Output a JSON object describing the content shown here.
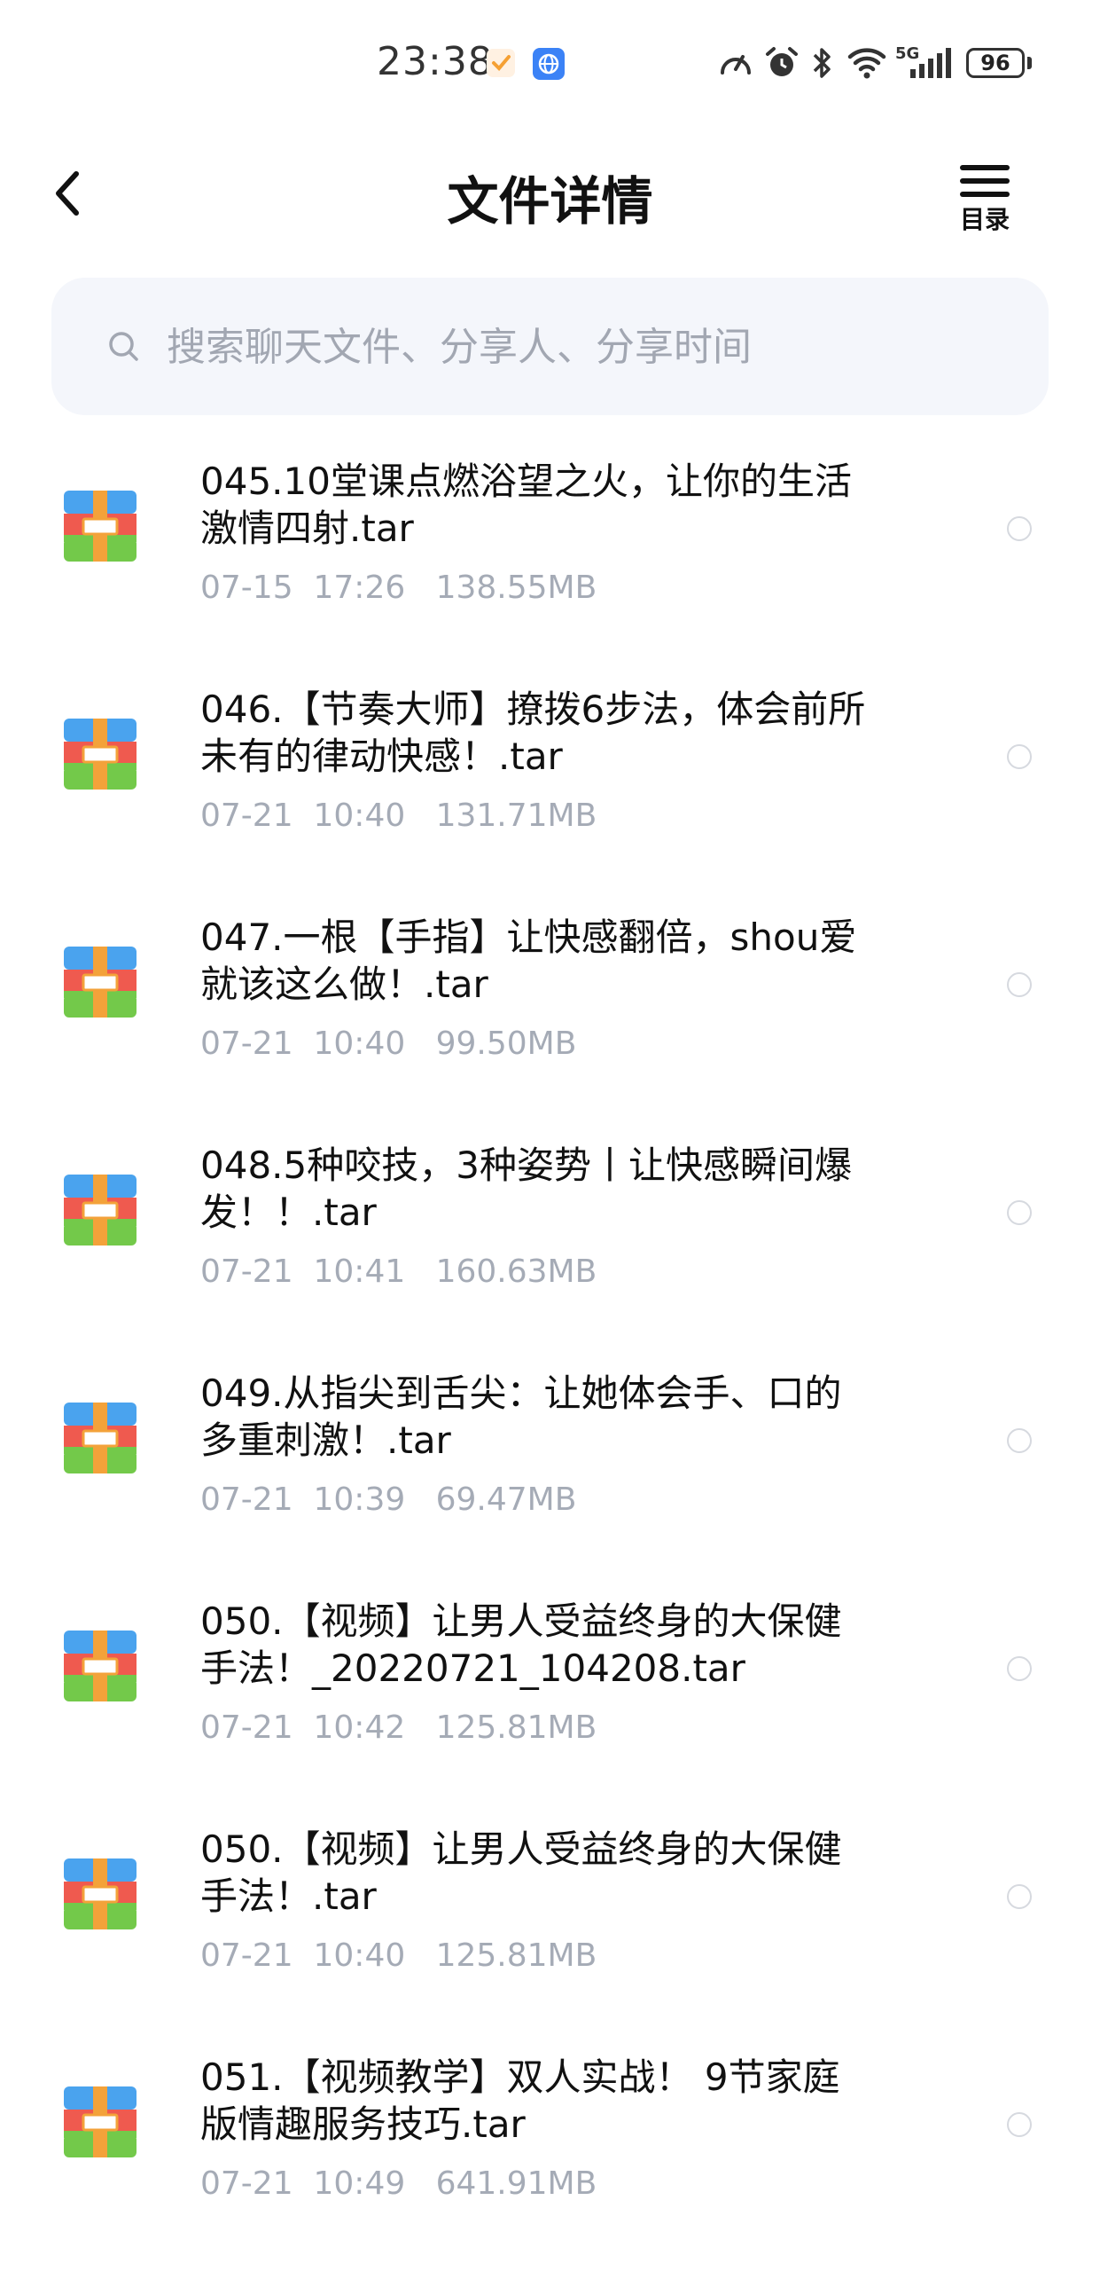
{
  "status_bar": {
    "time": "23:38",
    "battery": "96",
    "network": "5G"
  },
  "header": {
    "title": "文件详情",
    "toc_label": "目录"
  },
  "search": {
    "placeholder": "搜索聊天文件、分享人、分享时间"
  },
  "files": [
    {
      "line1": "045.10堂课点燃浴望之火，让你的生活",
      "line2": "激情四射.tar",
      "date": "07-15",
      "time": "17:26",
      "size": "138.55MB"
    },
    {
      "line1": "046.【节奏大师】撩拨6步法，体会前所",
      "line2": "未有的律动快感！.tar",
      "date": "07-21",
      "time": "10:40",
      "size": "131.71MB"
    },
    {
      "line1": "047.一根【手指】让快感翻倍，shou爱",
      "line2": "就该这么做！.tar",
      "date": "07-21",
      "time": "10:40",
      "size": "99.50MB"
    },
    {
      "line1": "048.5种咬技，3种姿势丨让快感瞬间爆",
      "line2": "发！！.tar",
      "date": "07-21",
      "time": "10:41",
      "size": "160.63MB"
    },
    {
      "line1": "049.从指尖到舌尖：让她体会手、口的",
      "line2": "多重刺激！.tar",
      "date": "07-21",
      "time": "10:39",
      "size": "69.47MB"
    },
    {
      "line1": "050.【视频】让男人受益终身的大保健",
      "line2": "手法！_20220721_104208.tar",
      "date": "07-21",
      "time": "10:42",
      "size": "125.81MB"
    },
    {
      "line1": "050.【视频】让男人受益终身的大保健",
      "line2": "手法！.tar",
      "date": "07-21",
      "time": "10:40",
      "size": "125.81MB"
    },
    {
      "line1": "051.【视频教学】双人实战！ 9节家庭",
      "line2": "版情趣服务技巧.tar",
      "date": "07-21",
      "time": "10:49",
      "size": "641.91MB"
    }
  ],
  "colors": {
    "meta_text": "#a5abb6",
    "search_bg": "#f4f6fb",
    "archive_blue": "#4aa3ee",
    "archive_red": "#ef5a4f",
    "archive_green": "#73c94a",
    "archive_orange": "#f3a23a"
  },
  "icons": {
    "back": "chevron-left-icon",
    "toc": "list-menu-icon",
    "search": "search-icon",
    "file": "archive-file-icon",
    "select": "radio-circle-icon"
  }
}
